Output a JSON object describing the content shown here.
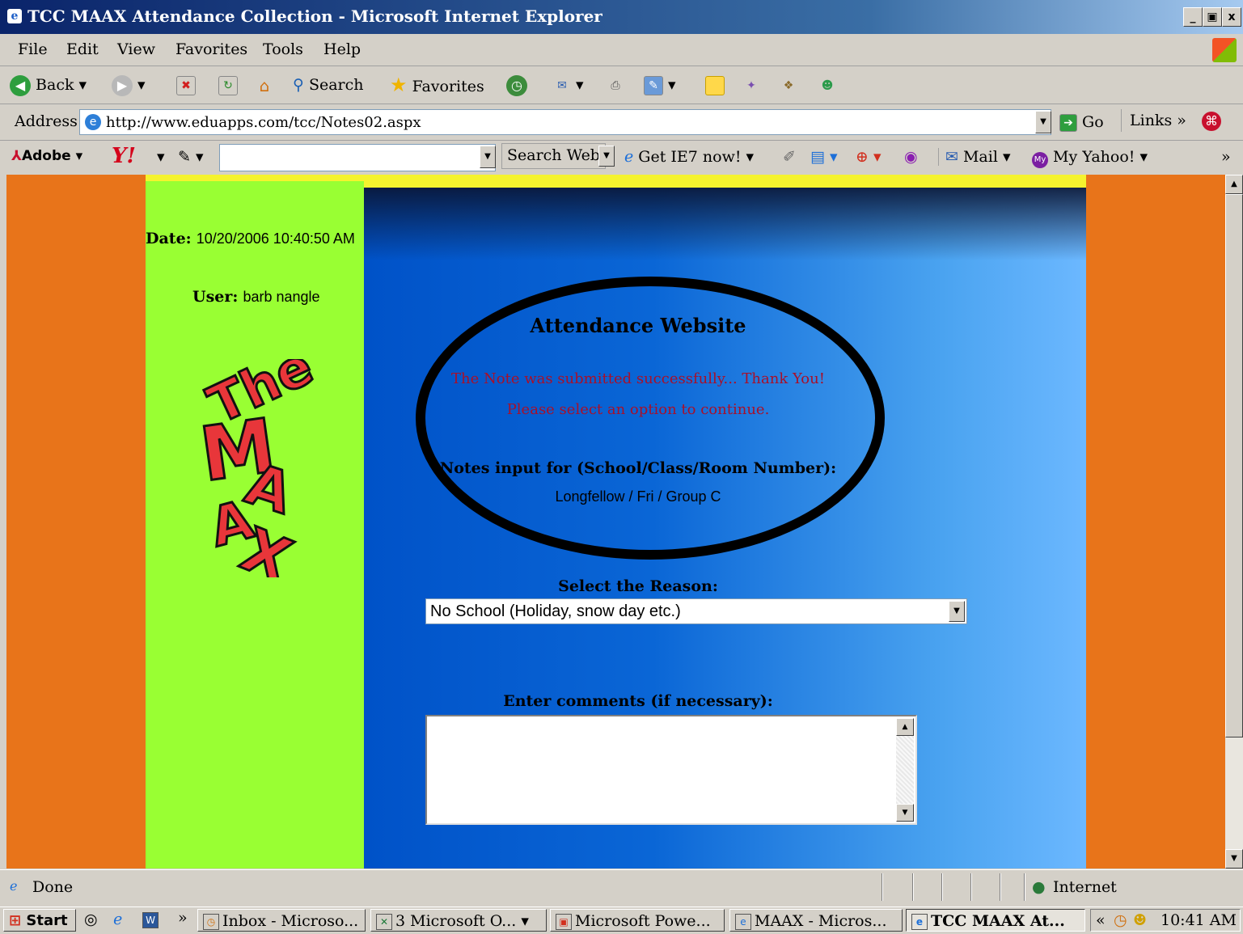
{
  "window": {
    "title": "TCC MAAX Attendance Collection - Microsoft Internet Explorer",
    "minimize": "_",
    "maximize": "Б",
    "close": "x"
  },
  "menu": [
    "File",
    "Edit",
    "View",
    "Favorites",
    "Tools",
    "Help"
  ],
  "toolbar": {
    "back": "Back",
    "search": "Search",
    "favorites": "Favorites"
  },
  "address": {
    "label": "Address",
    "url": "http://www.eduapps.com/tcc/Notes02.aspx",
    "go": "Go",
    "links": "Links"
  },
  "yahoo_toolbar": {
    "adobe": "Adobe",
    "yahoo": "Y!",
    "search_web": "Search Web",
    "get_ie7": "Get IE7 now!",
    "mail": "Mail",
    "my_yahoo": "My Yahoo!",
    "more": "»"
  },
  "page": {
    "date_label": "Date:",
    "date_value": "10/20/2006 10:40:50 AM",
    "user_label": "User:",
    "user_value": "barb nangle",
    "logo_text": "The MAAX",
    "heading": "Attendance Website",
    "success_msg": "The Note was submitted successfully... Thank You!",
    "continue_msg": "Please select an option to continue.",
    "notes_label": "Notes input for (School/Class/Room Number):",
    "notes_value": "Longfellow / Fri / Group C",
    "reason_label": "Select the Reason:",
    "reason_selected": "No School (Holiday, snow day etc.)",
    "comments_label": "Enter comments (if necessary):",
    "comments_value": ""
  },
  "status": {
    "text": "Done",
    "zone": "Internet"
  },
  "taskbar": {
    "start": "Start",
    "tasks": [
      "Inbox - Microso...",
      "3 Microsoft O...",
      "Microsoft Powe...",
      "MAAX - Micros...",
      "TCC MAAX At..."
    ],
    "clock": "10:41 AM"
  }
}
